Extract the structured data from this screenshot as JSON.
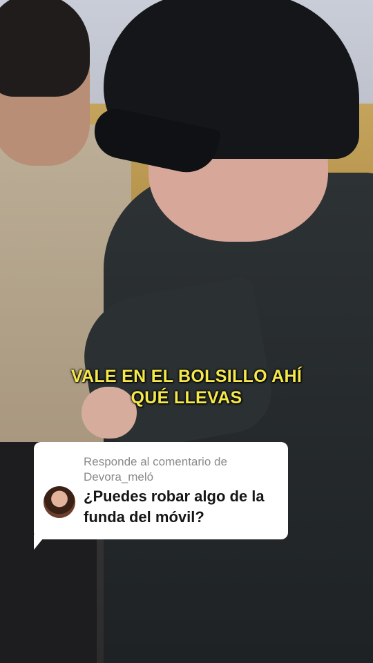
{
  "video": {
    "caption_lines": [
      "VALE EN EL BOLSILLO AHÍ",
      "QUÉ LLEVAS"
    ]
  },
  "comment_reply": {
    "reply_prefix": "Responde al comentario de",
    "username": "Devora_meló",
    "question": "¿Puedes robar algo de la funda del móvil?",
    "avatar_icon": "user-avatar-photo"
  },
  "colors": {
    "caption": "#f5e84a",
    "card_background": "#ffffff",
    "reply_text": "#8a8a8a",
    "question_text": "#161616"
  }
}
